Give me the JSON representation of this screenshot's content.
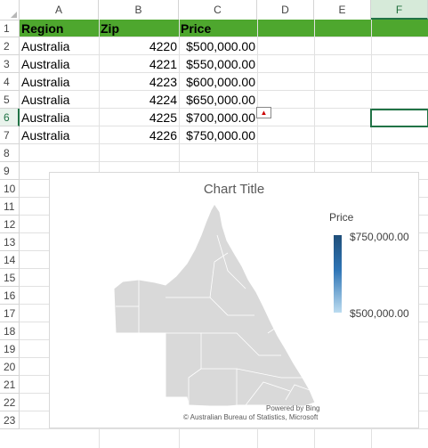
{
  "columns": [
    "A",
    "B",
    "C",
    "D",
    "E",
    "F"
  ],
  "selected_column": "F",
  "rows": [
    "1",
    "2",
    "3",
    "4",
    "5",
    "6",
    "7",
    "8",
    "9",
    "10",
    "11",
    "12",
    "13",
    "14",
    "15",
    "16",
    "17",
    "18",
    "19",
    "20",
    "21",
    "22",
    "23"
  ],
  "selected_row": "6",
  "table": {
    "headers": [
      "Region",
      "Zip",
      "Price"
    ],
    "rows": [
      [
        "Australia",
        "4220",
        "$500,000.00"
      ],
      [
        "Australia",
        "4221",
        "$550,000.00"
      ],
      [
        "Australia",
        "4223",
        "$600,000.00"
      ],
      [
        "Australia",
        "4224",
        "$650,000.00"
      ],
      [
        "Australia",
        "4225",
        "$700,000.00"
      ],
      [
        "Australia",
        "4226",
        "$750,000.00"
      ]
    ]
  },
  "colors": {
    "header_band": "#4ea72e",
    "selection": "#217346",
    "map_fill": "#d9d9d9",
    "legend_high": "#1f4e79",
    "legend_low": "#bcdcf0"
  },
  "chart": {
    "title": "Chart Title",
    "legend_title": "Price",
    "legend_max": "$750,000.00",
    "legend_min": "$500,000.00",
    "powered_by": "Powered by Bing",
    "copyright": "© Australian Bureau of Statistics, Microsoft"
  },
  "chart_data": {
    "type": "map",
    "title": "Chart Title",
    "region": "Queensland, Australia",
    "series": [
      {
        "name": "Price",
        "categories": [
          "4220",
          "4221",
          "4223",
          "4224",
          "4225",
          "4226"
        ],
        "values": [
          500000,
          550000,
          600000,
          650000,
          700000,
          750000
        ]
      }
    ],
    "color_scale": {
      "min": 500000,
      "max": 750000
    }
  }
}
